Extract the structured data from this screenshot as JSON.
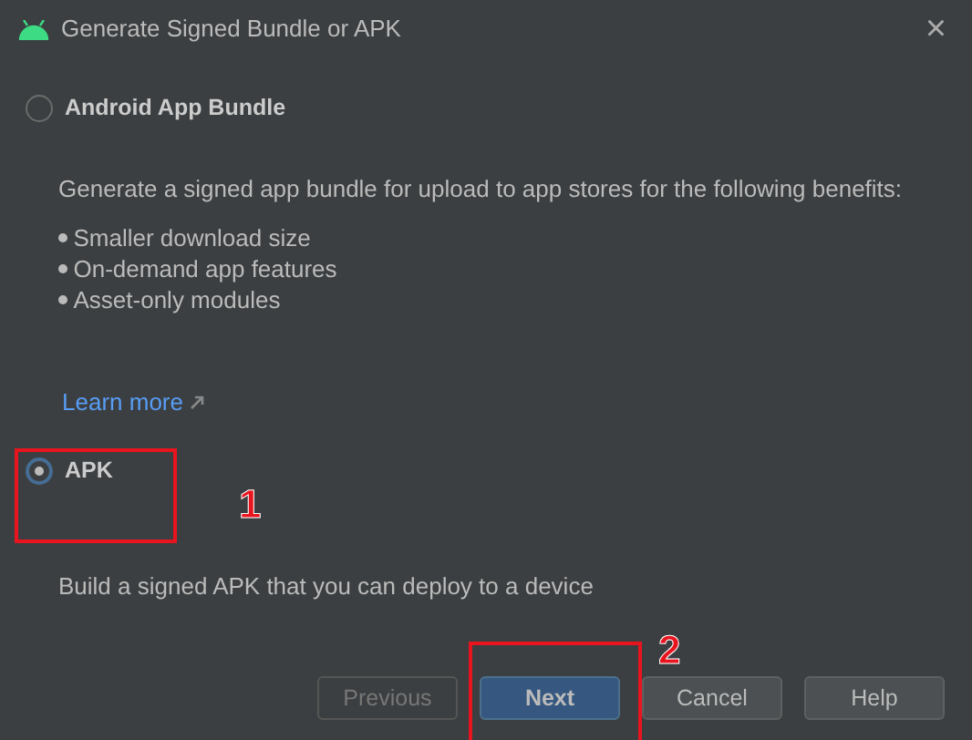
{
  "window": {
    "title": "Generate Signed Bundle or APK",
    "close": "×"
  },
  "options": [
    {
      "label": "Android App Bundle",
      "selected": false,
      "description": "Generate a signed app bundle for upload to app stores for the following benefits:",
      "benefits": [
        "Smaller download size",
        "On-demand app features",
        "Asset-only modules"
      ],
      "link": "Learn more"
    },
    {
      "label": "APK",
      "selected": true,
      "description": "Build a signed APK that you can deploy to a device"
    }
  ],
  "buttons": [
    {
      "label": "Previous",
      "disabled": true,
      "primary": false
    },
    {
      "label": "Next",
      "disabled": false,
      "primary": true
    },
    {
      "label": "Cancel",
      "disabled": false,
      "primary": false
    },
    {
      "label": "Help",
      "disabled": false,
      "primary": false
    }
  ],
  "annotations": [
    {
      "number": "1"
    },
    {
      "number": "2"
    }
  ]
}
